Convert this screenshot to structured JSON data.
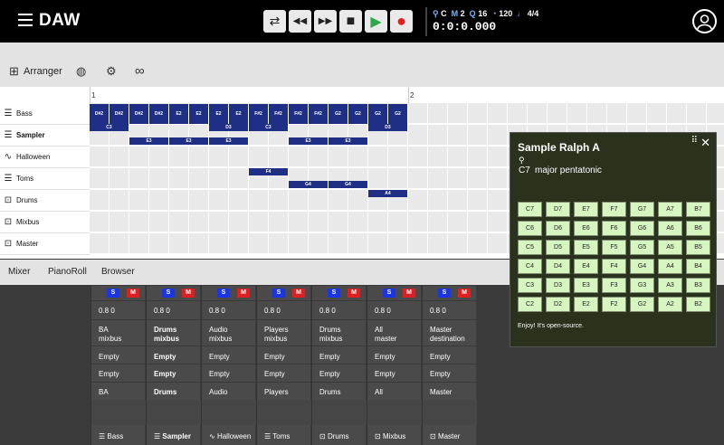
{
  "app": {
    "title": "DAW"
  },
  "transport": {
    "loop": "⇄",
    "rewind": "◀◀",
    "forward": "▶▶",
    "stop": "■",
    "play": "▶",
    "record": "●"
  },
  "status": {
    "key_label": "C",
    "mode": "M",
    "mode_val": "2",
    "q_label": "Q",
    "q_val": "16",
    "bpm": "120",
    "time_sig": "4/4",
    "time": "0:0:0.000"
  },
  "arranger": {
    "label": "Arranger"
  },
  "ruler": {
    "bar1": "1",
    "bar2": "2"
  },
  "tracks": [
    {
      "name": "Bass",
      "bold": false
    },
    {
      "name": "Sampler",
      "bold": true
    },
    {
      "name": "Halloween",
      "bold": false
    },
    {
      "name": "Toms",
      "bold": false
    },
    {
      "name": "Drums",
      "bold": false
    },
    {
      "name": "Mixbus",
      "bold": false
    },
    {
      "name": "Master",
      "bold": false
    }
  ],
  "notes_row0": [
    "D#2",
    "D#2",
    "D#2",
    "D#2",
    "E2",
    "E2",
    "E2",
    "E2",
    "F#2",
    "F#2",
    "F#2",
    "F#2",
    "G2",
    "G2",
    "G2",
    "G2"
  ],
  "notes": [
    {
      "row": 1,
      "col": 0,
      "w": 2,
      "label": "C3"
    },
    {
      "row": 1,
      "col": 6,
      "w": 2,
      "label": "D3"
    },
    {
      "row": 1,
      "col": 8,
      "w": 2,
      "label": "C3"
    },
    {
      "row": 1,
      "col": 14,
      "w": 2,
      "label": "D3"
    },
    {
      "row": 1.5,
      "col": 2,
      "w": 2,
      "label": "E3"
    },
    {
      "row": 1.5,
      "col": 4,
      "w": 2,
      "label": "E3"
    },
    {
      "row": 1.5,
      "col": 6,
      "w": 2,
      "label": "E3"
    },
    {
      "row": 1.5,
      "col": 10,
      "w": 2,
      "label": "E3"
    },
    {
      "row": 1.5,
      "col": 12,
      "w": 2,
      "label": "E3"
    },
    {
      "row": 3,
      "col": 8,
      "w": 2,
      "label": "F4"
    },
    {
      "row": 3.5,
      "col": 10,
      "w": 2,
      "label": "G4"
    },
    {
      "row": 3.5,
      "col": 12,
      "w": 2,
      "label": "G4"
    },
    {
      "row": 4,
      "col": 14,
      "w": 2,
      "label": "A4"
    }
  ],
  "lower_tabs": {
    "mixer": "Mixer",
    "pianoroll": "PianoRoll",
    "browser": "Browser"
  },
  "mixer": {
    "solo": "S",
    "mute": "M",
    "strips": [
      {
        "val": "0.8  0",
        "l1": "BA",
        "l2": "mixbus",
        "e1": "Empty",
        "e2": "Empty",
        "route": "BA",
        "name": "Bass",
        "bold": false
      },
      {
        "val": "0.8  0",
        "l1": "Drums",
        "l2": "mixbus",
        "e1": "Empty",
        "e2": "Empty",
        "route": "Drums",
        "name": "Sampler",
        "bold": true
      },
      {
        "val": "0.8  0",
        "l1": "Audio",
        "l2": "mixbus",
        "e1": "Empty",
        "e2": "Empty",
        "route": "Audio",
        "name": "Halloween",
        "bold": false
      },
      {
        "val": "0.8  0",
        "l1": "Players",
        "l2": "mixbus",
        "e1": "Empty",
        "e2": "Empty",
        "route": "Players",
        "name": "Toms",
        "bold": false
      },
      {
        "val": "0.8  0",
        "l1": "Drums",
        "l2": "mixbus",
        "e1": "Empty",
        "e2": "Empty",
        "route": "Drums",
        "name": "Drums",
        "bold": false
      },
      {
        "val": "0.8  0",
        "l1": "All",
        "l2": "master",
        "e1": "Empty",
        "e2": "Empty",
        "route": "All",
        "name": "Mixbus",
        "bold": false
      },
      {
        "val": "0.8  0",
        "l1": "Master",
        "l2": "destination",
        "e1": "Empty",
        "e2": "Empty",
        "route": "Master",
        "name": "Master",
        "bold": false
      }
    ]
  },
  "sample_panel": {
    "title": "Sample Ralph A",
    "key": "C7",
    "scale": "major pentatonic",
    "footer": "Enjoy! It's open-source.",
    "pads": [
      [
        "C7",
        "D7",
        "E7",
        "F7",
        "G7",
        "A7",
        "B7"
      ],
      [
        "C6",
        "D6",
        "E6",
        "F6",
        "G6",
        "A6",
        "B6"
      ],
      [
        "C5",
        "D5",
        "E5",
        "F5",
        "G5",
        "A5",
        "B5"
      ],
      [
        "C4",
        "D4",
        "E4",
        "F4",
        "G4",
        "A4",
        "B4"
      ],
      [
        "C3",
        "D3",
        "E3",
        "F3",
        "G3",
        "A3",
        "B3"
      ],
      [
        "C2",
        "D2",
        "E2",
        "F2",
        "G2",
        "A2",
        "B2"
      ]
    ]
  },
  "colors": {
    "note": "#1e2f85",
    "solo": "#1a35e8",
    "mute": "#e02020",
    "pad": "#d6f5c1",
    "panel": "#2a311d"
  }
}
